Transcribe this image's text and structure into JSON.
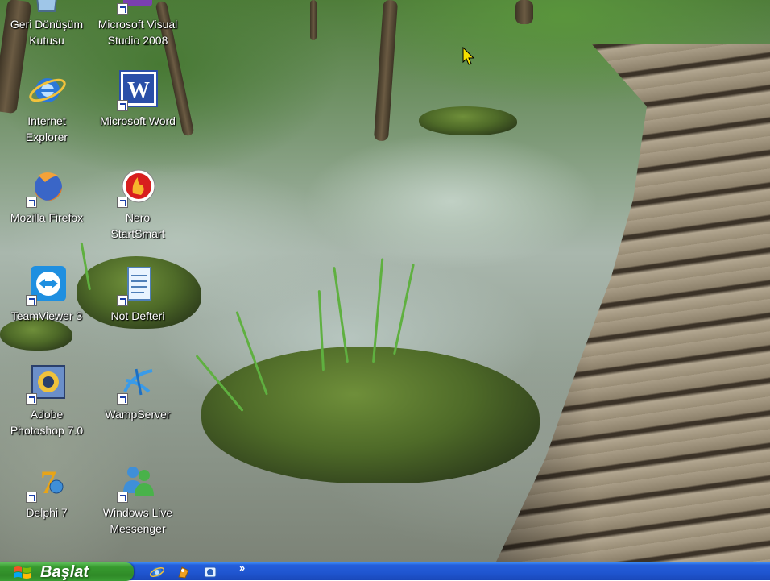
{
  "desktop": {
    "icons": [
      {
        "label": "Geri Dönüşüm\nKutusu",
        "icon": "recycle-bin-icon"
      },
      {
        "label": "Microsoft Visual\nStudio 2008",
        "icon": "visual-studio-icon"
      },
      {
        "label": "Internet\nExplorer",
        "icon": "internet-explorer-icon"
      },
      {
        "label": "Microsoft Word",
        "icon": "word-icon"
      },
      {
        "label": "Mozilla Firefox",
        "icon": "firefox-icon"
      },
      {
        "label": "Nero\nStartSmart",
        "icon": "nero-icon"
      },
      {
        "label": "TeamViewer 3",
        "icon": "teamviewer-icon"
      },
      {
        "label": "Not Defteri",
        "icon": "notepad-icon"
      },
      {
        "label": "Adobe\nPhotoshop 7.0",
        "icon": "photoshop-icon"
      },
      {
        "label": "WampServer",
        "icon": "wampserver-icon"
      },
      {
        "label": "Delphi 7",
        "icon": "delphi-icon"
      },
      {
        "label": "Windows Live\nMessenger",
        "icon": "messenger-icon"
      }
    ]
  },
  "taskbar": {
    "start_label": "Başlat",
    "quick_launch": [
      "internet-explorer-icon",
      "media-icon",
      "outlook-icon"
    ],
    "chevron": "»"
  },
  "colors": {
    "taskbar_blue": "#245edb",
    "start_green": "#379a2f"
  }
}
